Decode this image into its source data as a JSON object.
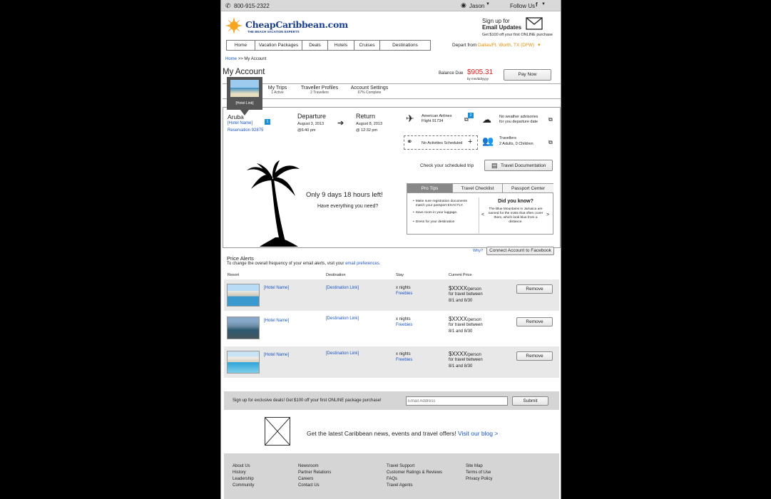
{
  "topbar": {
    "phone": "800-915-2322",
    "user": "Jason",
    "follow": "Follow Us"
  },
  "header": {
    "logo": "CheapCaribbean.com",
    "tagline": "THE BEACH VACATION EXPERTS",
    "signup_line1": "Sign up for",
    "signup_line2": "Email Updates",
    "signup_offer": "Get $100 off your first ONLINE purchase"
  },
  "nav": {
    "items": [
      "Home",
      "Vacation Packages",
      "Deals",
      "Hotels",
      "Cruises",
      "Destinations"
    ],
    "depart_label": "Depart from",
    "depart_value": "Dallas/Ft. Worth, TX (DFW)"
  },
  "breadcrumb": {
    "home": "Home",
    "sep": ">>",
    "current": "My Account"
  },
  "account": {
    "title": "My Account",
    "balance_label": "Balance Due",
    "balance_value": "$905.31",
    "balance_by": "by mm/dd/yyyy",
    "pay_label": "Pay Now"
  },
  "tabs": [
    {
      "label": "My Trips",
      "sub": "1 Active"
    },
    {
      "label": "Traveller Profiles",
      "sub": "2 Travellers"
    },
    {
      "label": "Account Settings",
      "sub": "67% Complete"
    }
  ],
  "hotel_popup": {
    "label": "[Hotel Link]"
  },
  "trip": {
    "destination": "Aruba",
    "hotel": "[Hotel Name]",
    "badge": "1",
    "reservation": "Reservation 92875",
    "departure_title": "Departure",
    "departure_date": "August 3, 2013",
    "departure_time": "@6:40 pm",
    "return_title": "Return",
    "return_date": "August 8, 2013",
    "return_time": "@ 12:32 pm",
    "airline": "American Airlines",
    "flight": "Flight 91734",
    "flight_badge": "2",
    "weather_line1": "No weather advisories",
    "weather_line2": "for you departure date",
    "activities": "No Activities Scheduled",
    "travellers_label": "Travellers",
    "travellers_value": "2 Adults, 0 Children",
    "check_text": "Check your scheduled trip",
    "doc_button": "Travel Documentation",
    "countdown": "Only 9 days 18 hours left!",
    "question": "Have everything you need?"
  },
  "pro": {
    "tabs": [
      "Pro Tips",
      "Travel Checklist",
      "Passport Center"
    ],
    "tips": [
      "Make sure registration documents match your passport EXACTLY.",
      "Save room in your luggage.",
      "Dress for your destination"
    ],
    "know_title": "Did you know?",
    "know_text": "The Blue Mountains in Jamaica are named for the mists that often cover them, which look blue from a distance."
  },
  "alerts": {
    "why": "Why?",
    "facebook": "Connect Account to Facebook",
    "title": "Price Alerts",
    "desc": "To change the overall frequency of your email alerts, visit your",
    "desc_link": "email preferences.",
    "headers": [
      "Resort",
      "Destination",
      "Stay",
      "Current Price"
    ],
    "rows": [
      {
        "hotel": "[Hotel Name]",
        "dest": "[Destination Link]",
        "nights": "x nights",
        "freebies": "Freebies",
        "price": "$XXXX",
        "per": "/person",
        "l1": "for travel between",
        "l2": "8/1 and 8/30",
        "remove": "Remove"
      },
      {
        "hotel": "[Hotel Name]",
        "dest": "[Destination Link]",
        "nights": "x nights",
        "freebies": "Freebies",
        "price": "$XXXX",
        "per": "/person",
        "l1": "for travel between",
        "l2": "8/1 and 8/30",
        "remove": "Remove"
      },
      {
        "hotel": "[Hotel Name]",
        "dest": "[Destination Link]",
        "nights": "x nights",
        "freebies": "Freebies",
        "price": "$XXXX",
        "per": "/person",
        "l1": "for travel between",
        "l2": "8/1 and 8/30",
        "remove": "Remove"
      }
    ]
  },
  "newsletter": {
    "text": "Sign up for exclusive deals! Get $100 off your first ONLINE package purchase!",
    "placeholder": "Email Address",
    "submit": "Submit"
  },
  "blog": {
    "text": "Get the latest Caribbean news, events and travel offers!",
    "link": "Visit our blog >"
  },
  "footer": {
    "col1": [
      "About Us",
      "History",
      "Leadership",
      "Community"
    ],
    "col2": [
      "Newsroom",
      "Partner Relations",
      "Careers",
      "Contact Us"
    ],
    "col3": [
      "Travel Support",
      "Customer Ratings & Reviews",
      "FAQs",
      "Travel Agents"
    ],
    "col4": [
      "Site Map",
      "Terms of Use",
      "Privacy Policy"
    ]
  }
}
